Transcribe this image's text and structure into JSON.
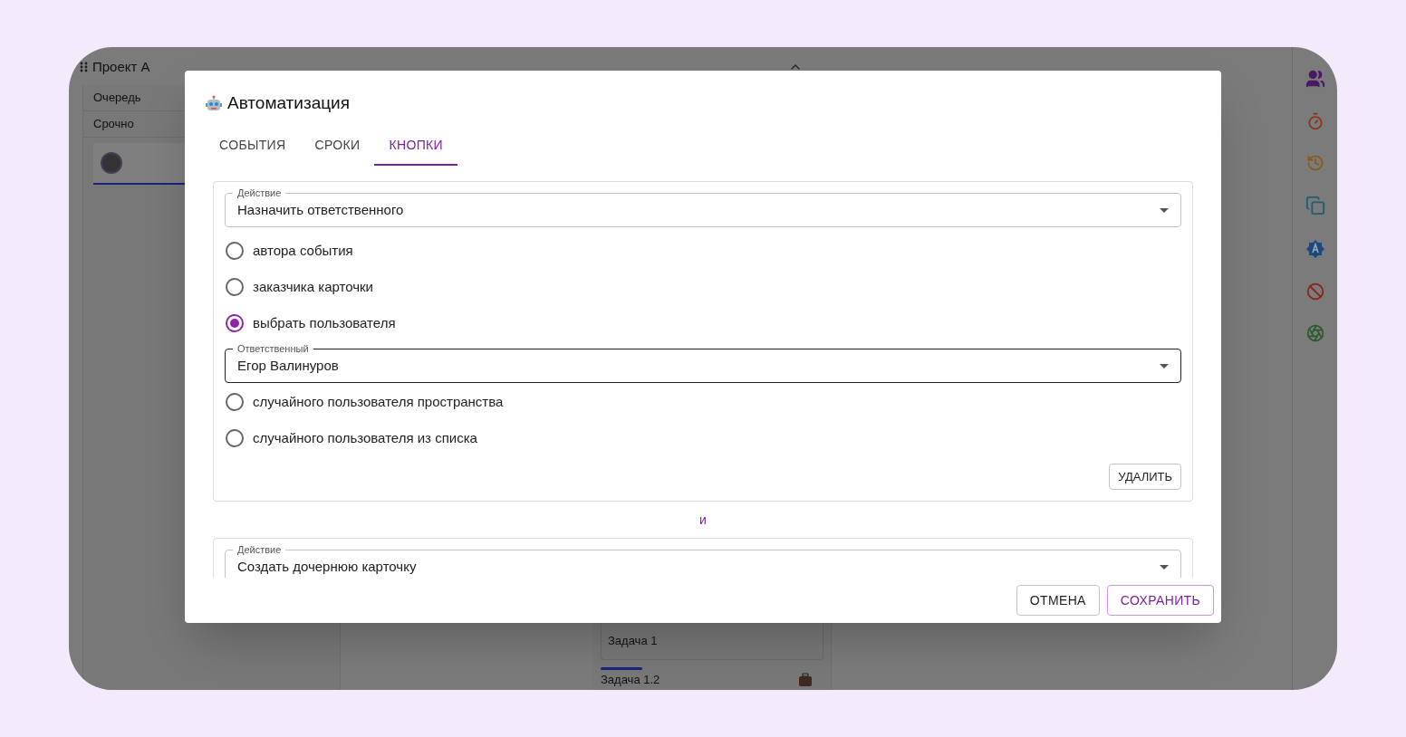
{
  "project": {
    "title": "Проект А",
    "lanes": [
      {
        "label": "Очередь"
      },
      {
        "label": "Срочно"
      }
    ]
  },
  "cards": [
    {
      "title": "Задача 1"
    },
    {
      "title": "Задача 1.2"
    }
  ],
  "dialog": {
    "title": "Автоматизация",
    "tabs": [
      {
        "label": "СОБЫТИЯ",
        "selected": false
      },
      {
        "label": "СРОКИ",
        "selected": false
      },
      {
        "label": "КНОПКИ",
        "selected": true
      }
    ],
    "actions": [
      {
        "field_label": "Действие",
        "value": "Назначить ответственного",
        "options": [
          {
            "label": "автора события",
            "selected": false
          },
          {
            "label": "заказчика карточки",
            "selected": false
          },
          {
            "label": "выбрать пользователя",
            "selected": true,
            "assignee": {
              "field_label": "Ответственный",
              "value": "Егор Валинуров"
            }
          },
          {
            "label": "случайного пользователя пространства",
            "selected": false
          },
          {
            "label": "случайного пользователя из списка",
            "selected": false
          }
        ],
        "delete_label": "УДАЛИТЬ"
      },
      {
        "field_label": "Действие",
        "value": "Создать дочернюю карточку"
      }
    ],
    "connector": "и",
    "buttons": [
      {
        "label": "ОТМЕНА",
        "kind": "default"
      },
      {
        "label": "СОХРАНИТЬ",
        "kind": "primary"
      }
    ]
  }
}
